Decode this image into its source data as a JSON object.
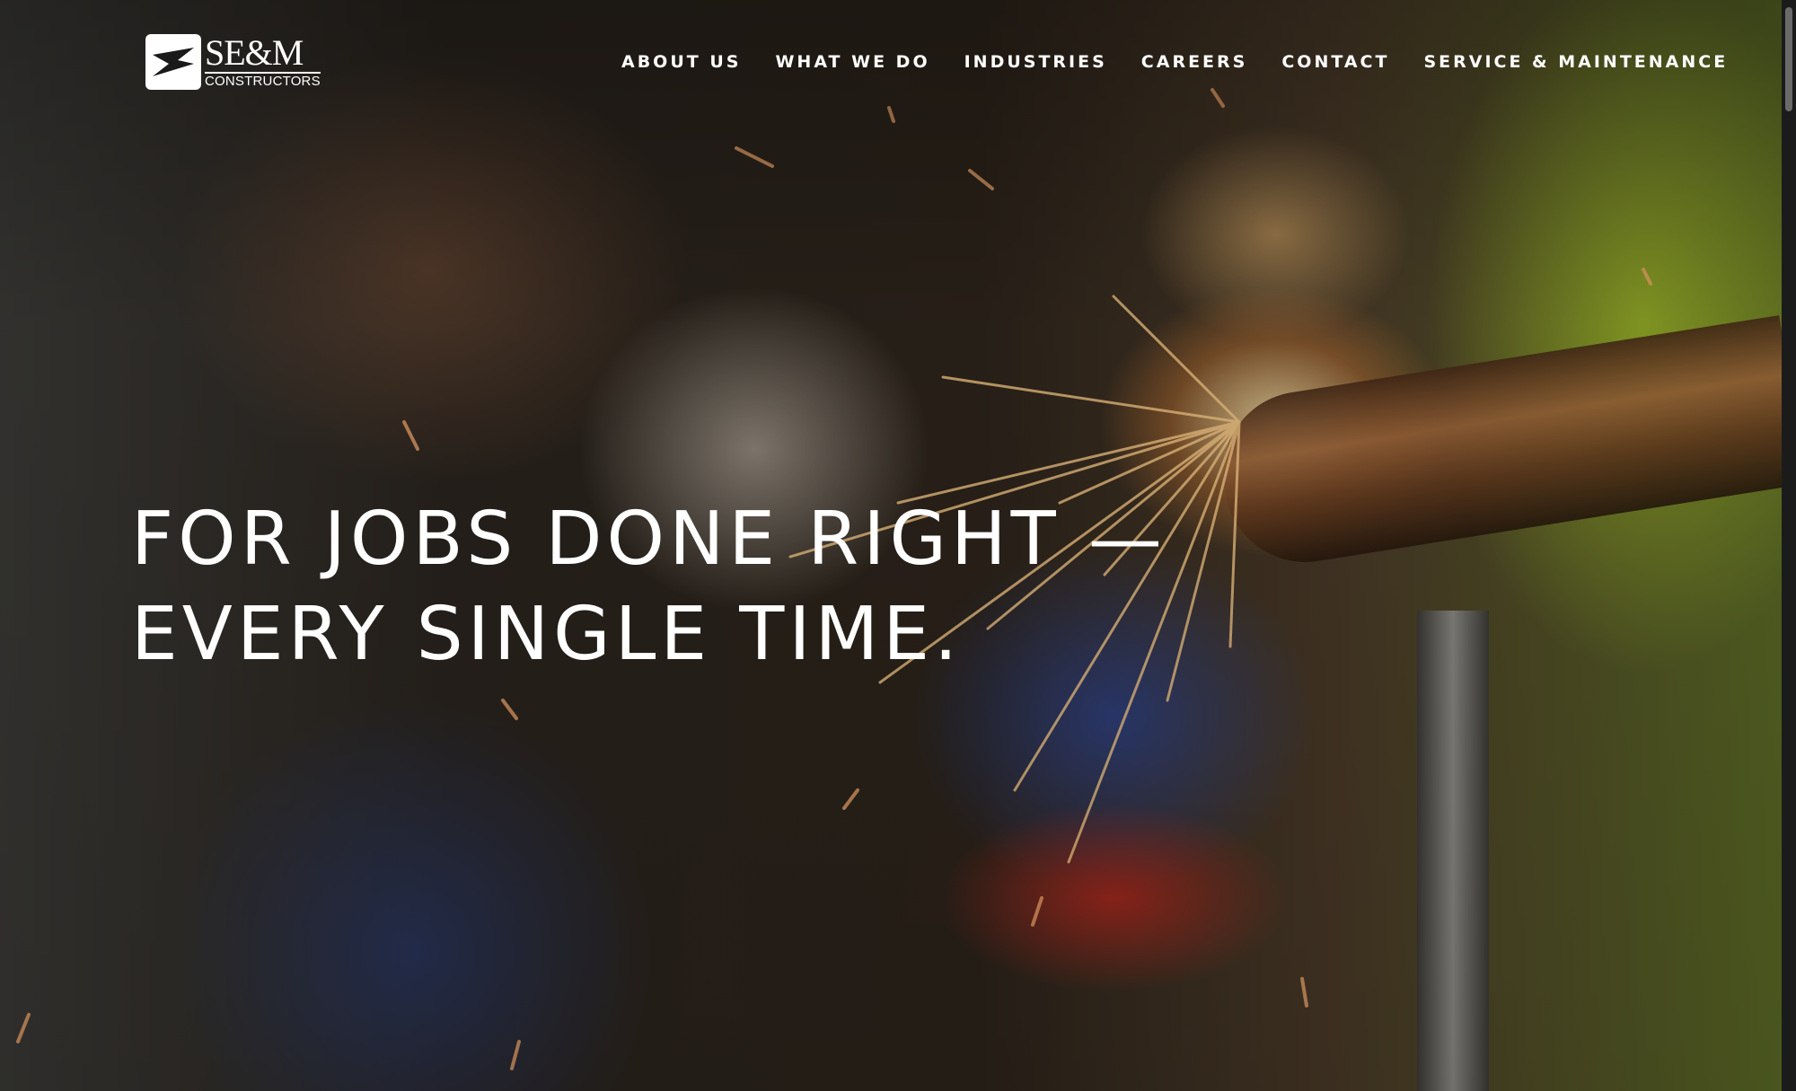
{
  "logo": {
    "name": "SE&M",
    "subtitle": "CONSTRUCTORS"
  },
  "nav": {
    "items": [
      {
        "label": "ABOUT US"
      },
      {
        "label": "WHAT WE DO"
      },
      {
        "label": "INDUSTRIES"
      },
      {
        "label": "CAREERS"
      },
      {
        "label": "CONTACT"
      },
      {
        "label": "SERVICE & MAINTENANCE"
      }
    ]
  },
  "hero": {
    "headline_line1": "FOR JOBS DONE RIGHT —",
    "headline_line2": "EVERY SINGLE TIME.",
    "background_image": "welder-sparks-photo"
  },
  "colors": {
    "text": "#ffffff",
    "logo_mark": "#ffffff"
  }
}
